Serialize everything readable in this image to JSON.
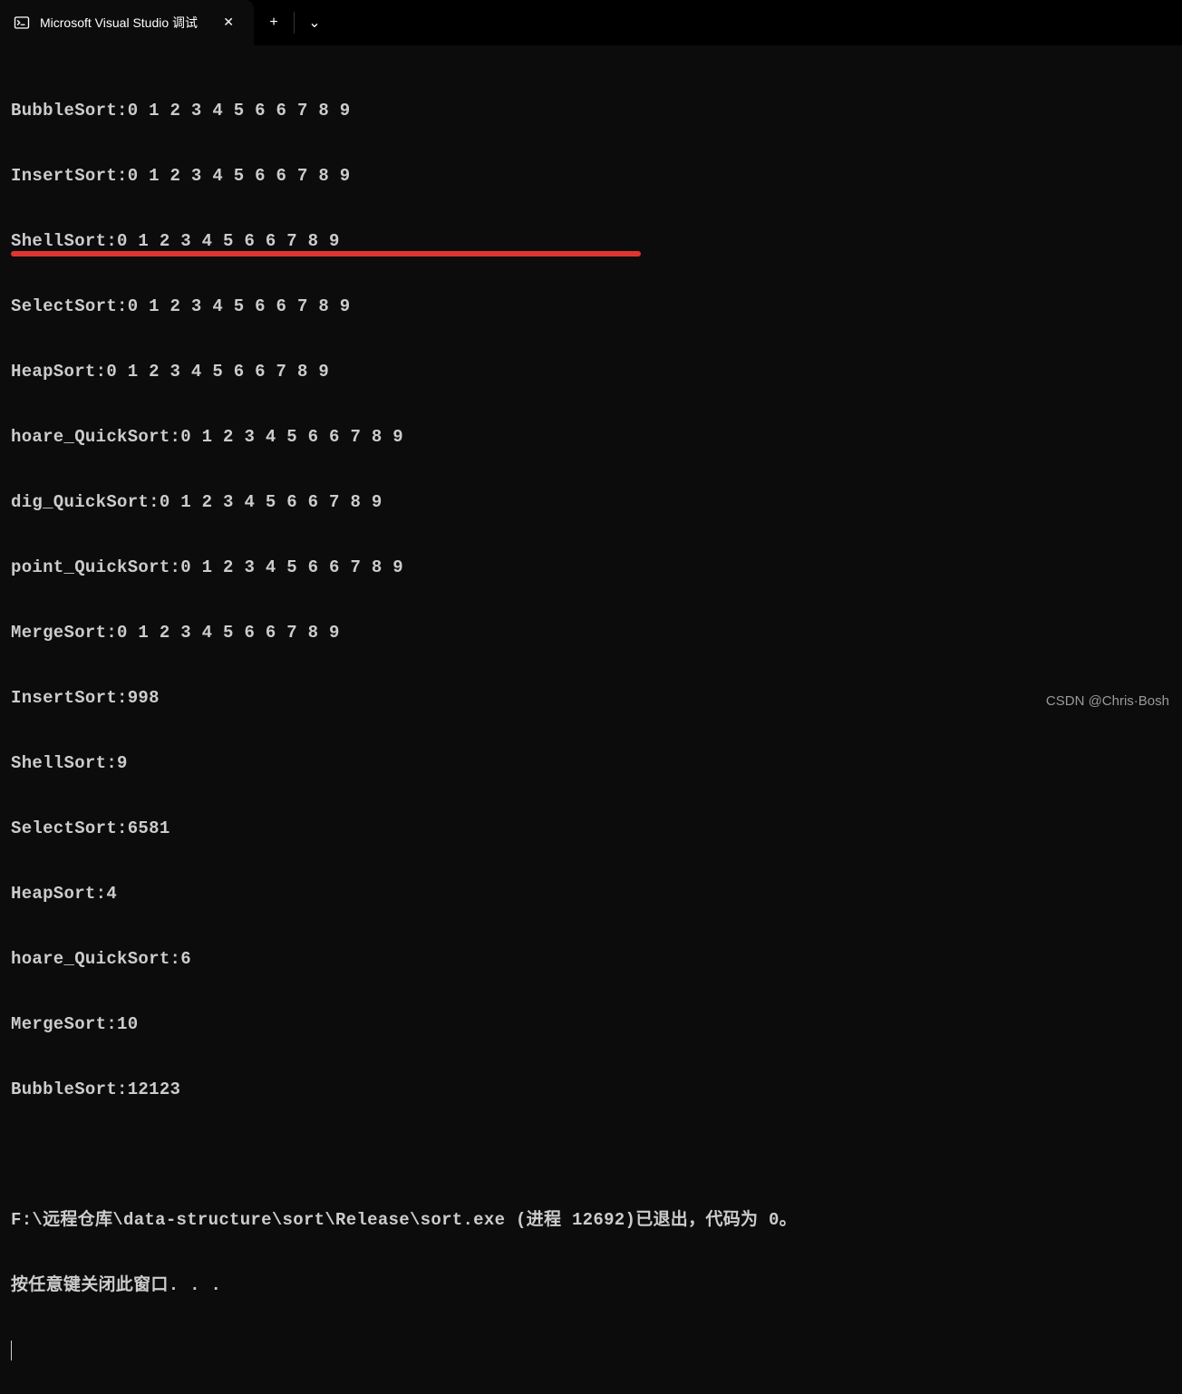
{
  "titlebar": {
    "tab": {
      "title": "Microsoft Visual Studio 调试",
      "icon_name": "terminal-icon"
    },
    "close_label": "✕",
    "new_tab_label": "+",
    "dropdown_label": "⌄"
  },
  "terminal": {
    "lines": [
      "BubbleSort:0 1 2 3 4 5 6 6 7 8 9",
      "InsertSort:0 1 2 3 4 5 6 6 7 8 9",
      "ShellSort:0 1 2 3 4 5 6 6 7 8 9",
      "SelectSort:0 1 2 3 4 5 6 6 7 8 9",
      "HeapSort:0 1 2 3 4 5 6 6 7 8 9",
      "hoare_QuickSort:0 1 2 3 4 5 6 6 7 8 9",
      "dig_QuickSort:0 1 2 3 4 5 6 6 7 8 9",
      "point_QuickSort:0 1 2 3 4 5 6 6 7 8 9",
      "MergeSort:0 1 2 3 4 5 6 6 7 8 9",
      "InsertSort:998",
      "ShellSort:9",
      "SelectSort:6581",
      "HeapSort:4",
      "hoare_QuickSort:6",
      "MergeSort:10",
      "BubbleSort:12123",
      "",
      "F:\\远程仓库\\data-structure\\sort\\Release\\sort.exe (进程 12692)已退出，代码为 0。",
      "按任意键关闭此窗口. . ."
    ]
  },
  "watermark": "CSDN @Chris·Bosh"
}
